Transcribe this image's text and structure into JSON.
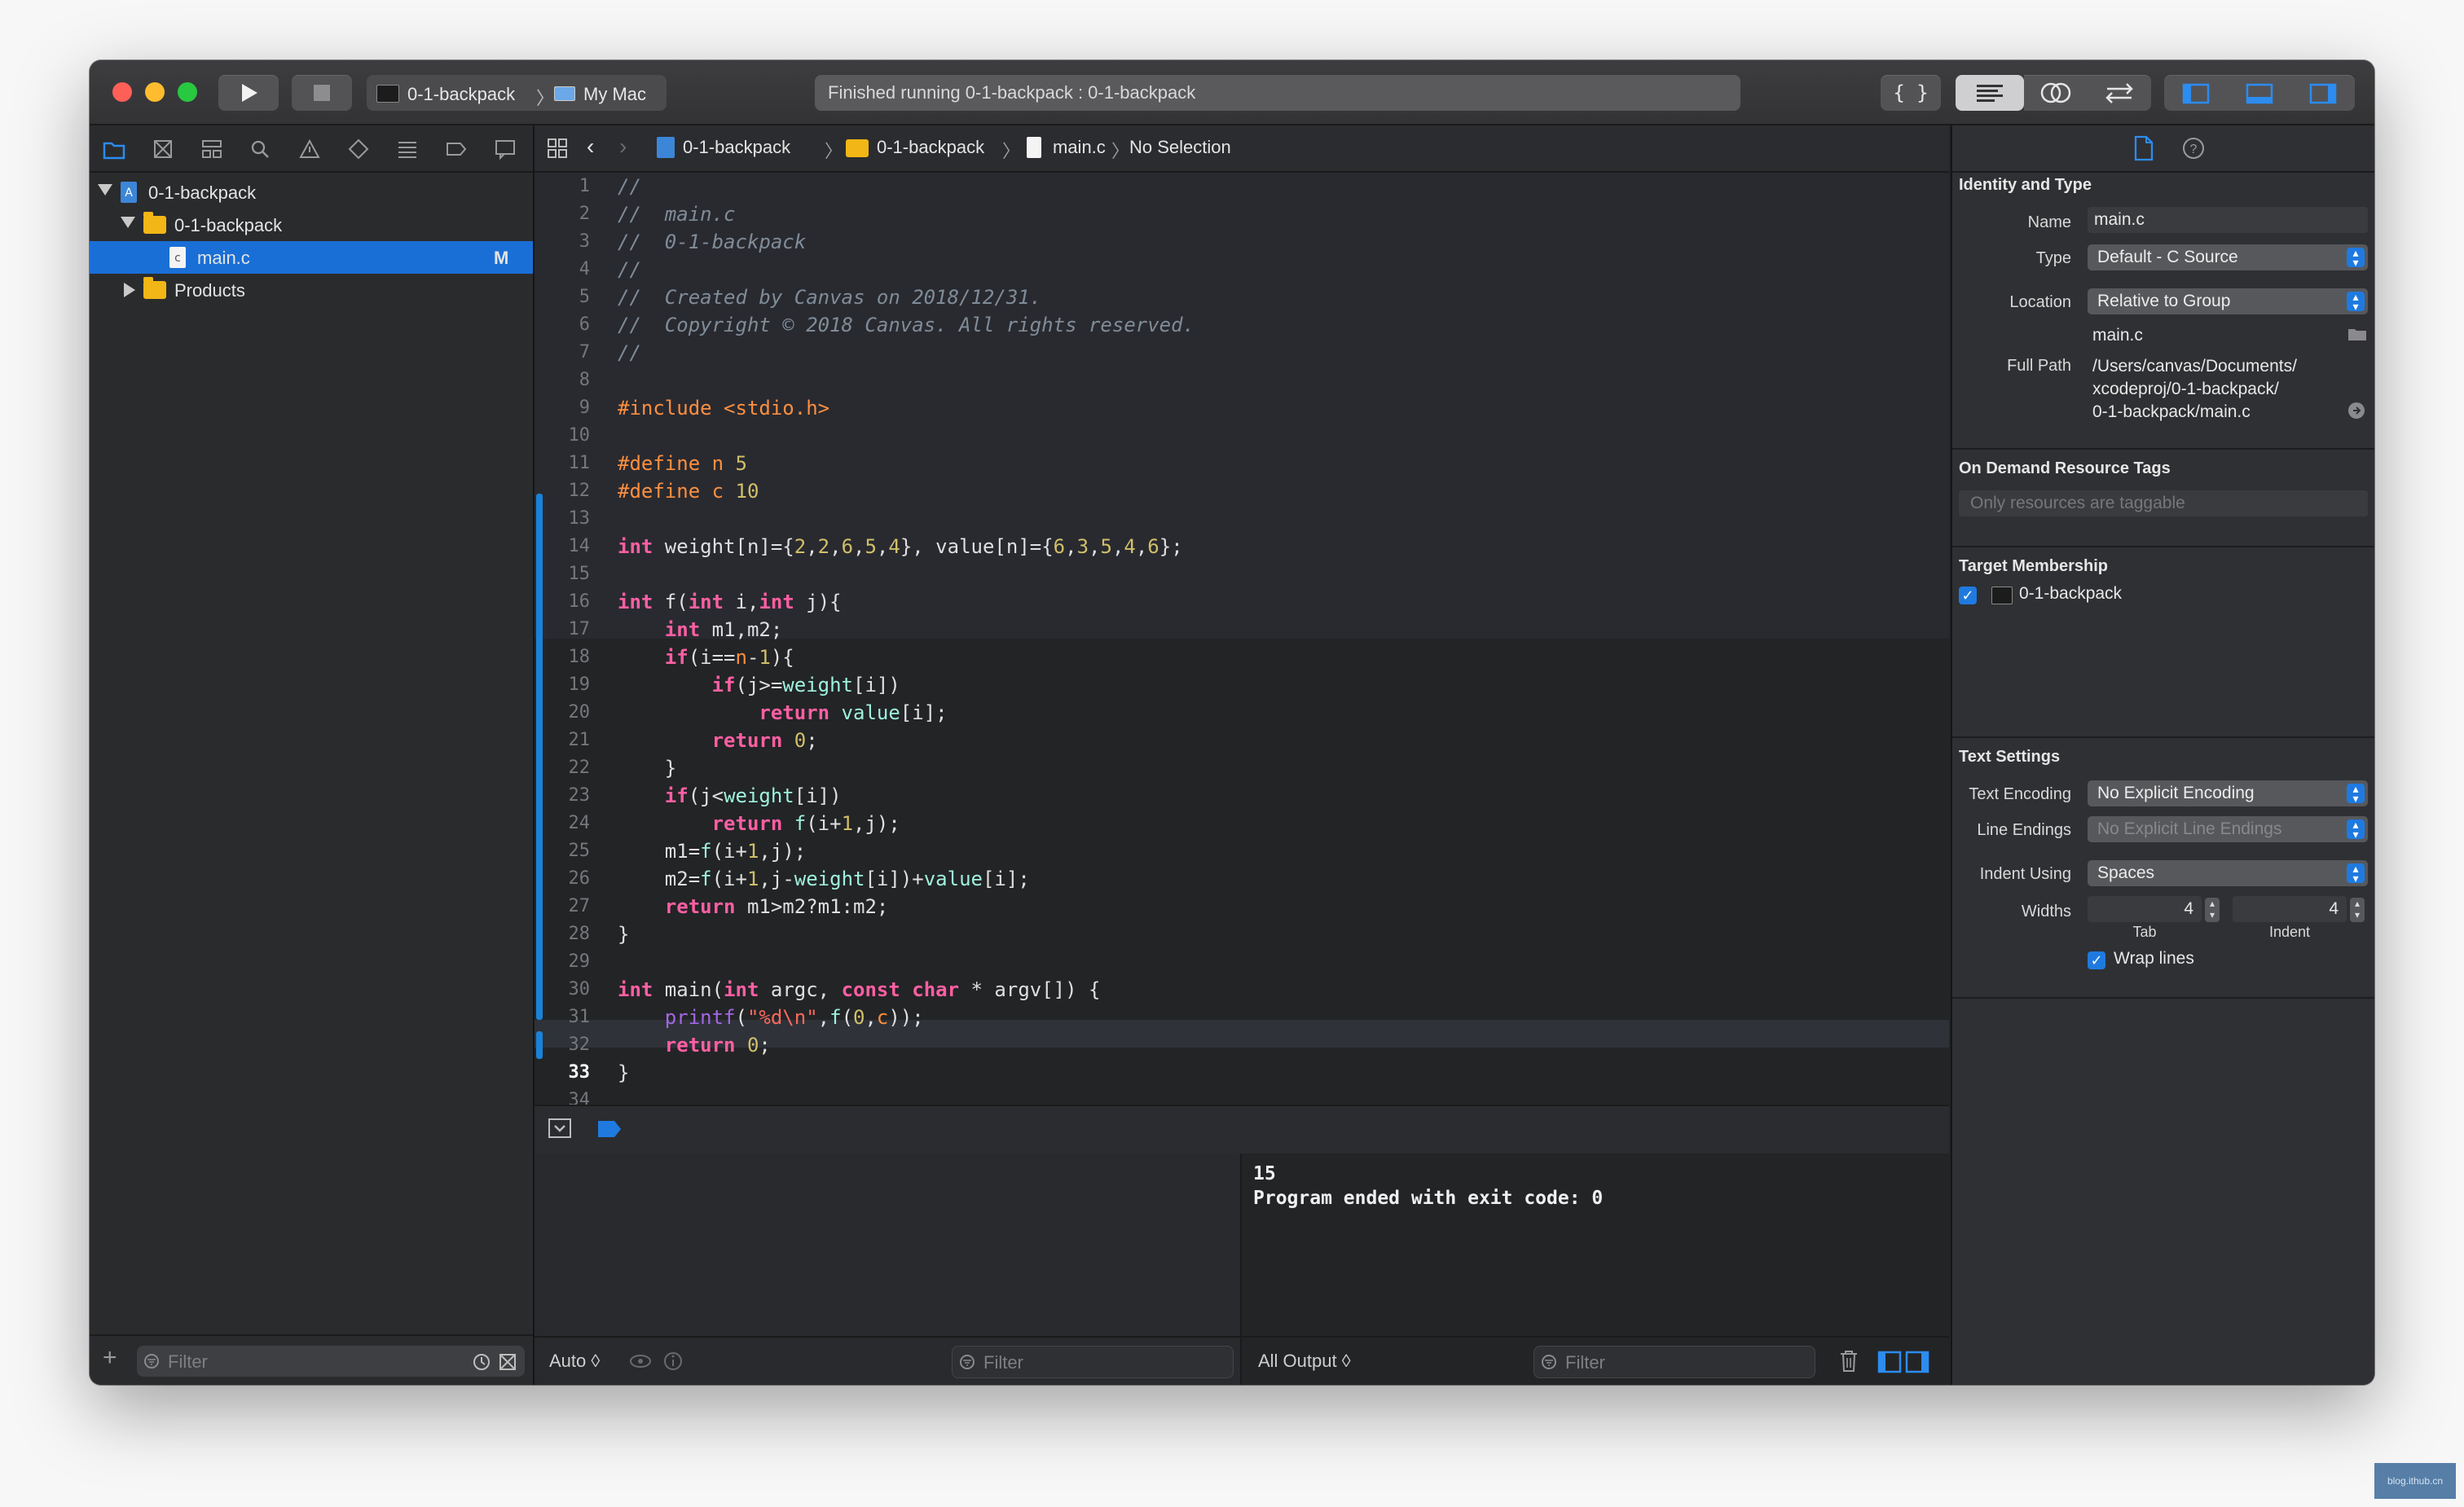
{
  "toolbar": {
    "scheme_target": "0-1-backpack",
    "scheme_device": "My Mac",
    "activity_status": "Finished running 0-1-backpack : 0-1-backpack",
    "code_snippet_glyph": "{ }"
  },
  "navigator": {
    "tree": [
      {
        "label": "0-1-backpack",
        "kind": "project"
      },
      {
        "label": "0-1-backpack",
        "kind": "group"
      },
      {
        "label": "main.c",
        "kind": "file",
        "badge": "M",
        "selected": true
      },
      {
        "label": "Products",
        "kind": "group"
      }
    ],
    "filter_placeholder": "Filter"
  },
  "jumpbar": {
    "project": "0-1-backpack",
    "group": "0-1-backpack",
    "file": "main.c",
    "selection": "No Selection"
  },
  "editor": {
    "current_line": 33,
    "line_numbers": [
      "1",
      "2",
      "3",
      "4",
      "5",
      "6",
      "7",
      "8",
      "9",
      "10",
      "11",
      "12",
      "13",
      "14",
      "15",
      "16",
      "17",
      "18",
      "19",
      "20",
      "21",
      "22",
      "23",
      "24",
      "25",
      "26",
      "27",
      "28",
      "29",
      "30",
      "31",
      "32",
      "33",
      "34"
    ]
  },
  "debug": {
    "scope": "Auto ◊",
    "filter_placeholder": "Filter",
    "output_mode": "All Output ◊",
    "console_lines": [
      "15",
      "Program ended with exit code: 0"
    ]
  },
  "inspector": {
    "identity_title": "Identity and Type",
    "name_label": "Name",
    "name_value": "main.c",
    "type_label": "Type",
    "type_value": "Default - C Source",
    "location_label": "Location",
    "location_value": "Relative to Group",
    "location_file": "main.c",
    "fullpath_label": "Full Path",
    "fullpath_value": [
      "/Users/canvas/Documents/",
      "xcodeproj/0-1-backpack/",
      "0-1-backpack/main.c"
    ],
    "odr_title": "On Demand Resource Tags",
    "odr_placeholder": "Only resources are taggable",
    "target_title": "Target Membership",
    "target_name": "0-1-backpack",
    "text_settings_title": "Text Settings",
    "encoding_label": "Text Encoding",
    "encoding_value": "No Explicit Encoding",
    "line_endings_label": "Line Endings",
    "line_endings_value": "No Explicit Line Endings",
    "indent_using_label": "Indent Using",
    "indent_using_value": "Spaces",
    "widths_label": "Widths",
    "tab_width": "4",
    "indent_width": "4",
    "tab_caption": "Tab",
    "indent_caption": "Indent",
    "wrap_label": "Wrap lines"
  },
  "watermark": "blog.ithub.cn",
  "colors": {
    "accent": "#1f7ae0",
    "selection": "#1a6fd6",
    "keyword": "#fc5fa3",
    "preprocessor": "#fd8f3f",
    "number": "#d0bf69",
    "comment": "#7f8c98",
    "string": "#fc6a5d"
  }
}
